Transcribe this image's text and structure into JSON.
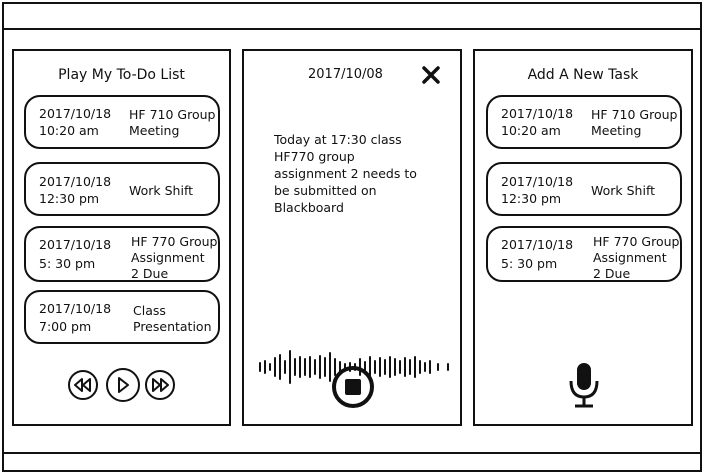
{
  "left_panel": {
    "title": "Play My To-Do List",
    "tasks": [
      {
        "date": "2017/10/18",
        "time": "10:20 am",
        "desc1": "HF 710 Group",
        "desc2": "Meeting",
        "desc3": ""
      },
      {
        "date": "2017/10/18",
        "time": "12:30 pm",
        "desc1": "Work Shift",
        "desc2": "",
        "desc3": ""
      },
      {
        "date": "2017/10/18",
        "time": "5: 30 pm",
        "desc1": "HF 770 Group",
        "desc2": "Assignment",
        "desc3": "2 Due"
      },
      {
        "date": "2017/10/18",
        "time": "7:00 pm",
        "desc1": "Class",
        "desc2": "Presentation",
        "desc3": ""
      }
    ],
    "controls": [
      "rewind-icon",
      "play-icon",
      "fast-forward-icon"
    ]
  },
  "middle_panel": {
    "date": "2017/10/08",
    "message_lines": [
      "Today at 17:30 class",
      "HF770 group",
      "assignment 2 needs to",
      "be submitted on",
      "Blackboard"
    ],
    "close_icon": "close-icon",
    "waveform_icon": "audio-waveform",
    "stop_icon": "stop-icon"
  },
  "right_panel": {
    "title": "Add A New Task",
    "tasks": [
      {
        "date": "2017/10/18",
        "time": "10:20 am",
        "desc1": "HF 710 Group",
        "desc2": "Meeting",
        "desc3": ""
      },
      {
        "date": "2017/10/18",
        "time": "12:30 pm",
        "desc1": "Work Shift",
        "desc2": "",
        "desc3": ""
      },
      {
        "date": "2017/10/18",
        "time": "5: 30 pm",
        "desc1": "HF 770 Group",
        "desc2": "Assignment",
        "desc3": "2 Due"
      }
    ],
    "mic_icon": "microphone-icon"
  }
}
